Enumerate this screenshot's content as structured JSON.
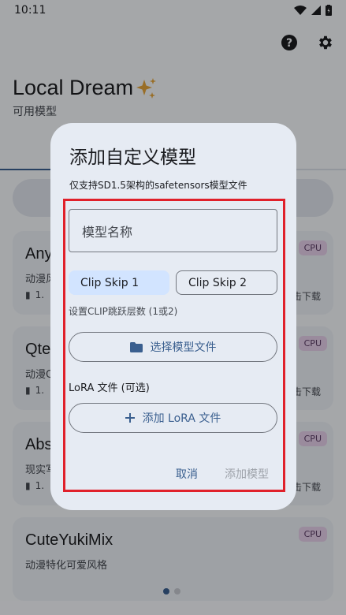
{
  "status_bar": {
    "time": "10:11"
  },
  "header": {
    "title": "Local Dream",
    "subtitle": "可用模型",
    "icons": [
      "help-icon",
      "gear-icon",
      "sparkles-icon"
    ]
  },
  "cards": [
    {
      "name": "Any",
      "desc": "动漫风",
      "meta": "1.",
      "badge": "CPU",
      "download": "击下载"
    },
    {
      "name": "Qte",
      "desc": "动漫Q",
      "meta": "1.",
      "badge": "CPU",
      "download": "击下载"
    },
    {
      "name": "Abs",
      "desc": "现实写",
      "meta": "1.",
      "badge": "CPU",
      "download": "击下载"
    },
    {
      "name": "CuteYukiMix",
      "desc": "动漫特化可爱风格",
      "meta": "",
      "badge": "CPU",
      "download": ""
    }
  ],
  "dialog": {
    "title": "添加自定义模型",
    "hint": "仅支持SD1.5架构的safetensors模型文件",
    "model_name_placeholder": "模型名称",
    "clip_skip_1": "Clip Skip 1",
    "clip_skip_2": "Clip Skip 2",
    "clip_hint": "设置CLIP跳跃层数 (1或2)",
    "select_model_label": "选择模型文件",
    "lora_label": "LoRA 文件 (可选)",
    "add_lora_label": "添加 LoRA 文件",
    "cancel_label": "取消",
    "confirm_label": "添加模型"
  },
  "colors": {
    "accent": "#3a5f8f",
    "highlight": "#e0202a",
    "badge_bg": "#e3cde8"
  }
}
